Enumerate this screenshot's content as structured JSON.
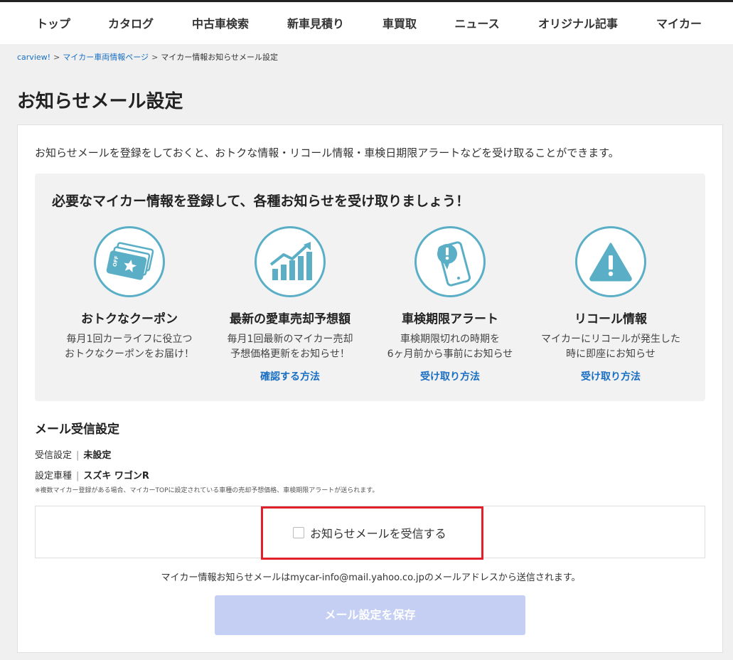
{
  "nav": {
    "items": [
      {
        "label": "トップ"
      },
      {
        "label": "カタログ"
      },
      {
        "label": "中古車検索"
      },
      {
        "label": "新車見積り"
      },
      {
        "label": "車買取"
      },
      {
        "label": "ニュース"
      },
      {
        "label": "オリジナル記事"
      },
      {
        "label": "マイカー"
      }
    ]
  },
  "breadcrumb": {
    "items": [
      "carview!",
      "マイカー車両情報ページ",
      "マイカー情報お知らせメール設定"
    ],
    "separator": ">"
  },
  "page_title": "お知らせメール設定",
  "intro": "お知らせメールを登録をしておくと、おトクな情報・リコール情報・車検日期限アラートなどを受け取ることができます。",
  "benefits": {
    "heading": "必要なマイカー情報を登録して、各種お知らせを受け取りましょう！",
    "features": [
      {
        "icon": "coupon-icon",
        "title": "おトクなクーポン",
        "desc1": "毎月1回カーライフに役立つ",
        "desc2": "おトクなクーポンをお届け！",
        "link": "",
        "icon_text": "OFF"
      },
      {
        "icon": "chart-up-icon",
        "title": "最新の愛車売却予想額",
        "desc1": "毎月1回最新のマイカー売却",
        "desc2": "予想価格更新をお知らせ！",
        "link": "確認する方法"
      },
      {
        "icon": "phone-alert-icon",
        "title": "車検期限アラート",
        "desc1": "車検期限切れの時期を",
        "desc2": "6ヶ月前から事前にお知らせ",
        "link": "受け取り方法"
      },
      {
        "icon": "warning-icon",
        "title": "リコール情報",
        "desc1": "マイカーにリコールが発生した",
        "desc2": "時に即座にお知らせ",
        "link": "受け取り方法"
      }
    ]
  },
  "mail_settings": {
    "heading": "メール受信設定",
    "receive_label": "受信設定",
    "receive_value": "未設定",
    "car_label": "設定車種",
    "car_value": "スズキ ワゴンR",
    "separator": "|",
    "note": "※複数マイカー登録がある場合、マイカーTOPに設定されている車種の売却予想価格、車検期限アラートが送られます。",
    "checkbox_label": "お知らせメールを受信する",
    "checkbox_checked": false,
    "sender_note": "マイカー情報お知らせメールはmycar-info@mail.yahoo.co.jpのメールアドレスから送信されます。",
    "save_label": "メール設定を保存"
  },
  "colors": {
    "accent": "#5aafc7",
    "link": "#1a6fc2",
    "highlight": "#e0212b",
    "button_disabled": "#c5cff4"
  }
}
